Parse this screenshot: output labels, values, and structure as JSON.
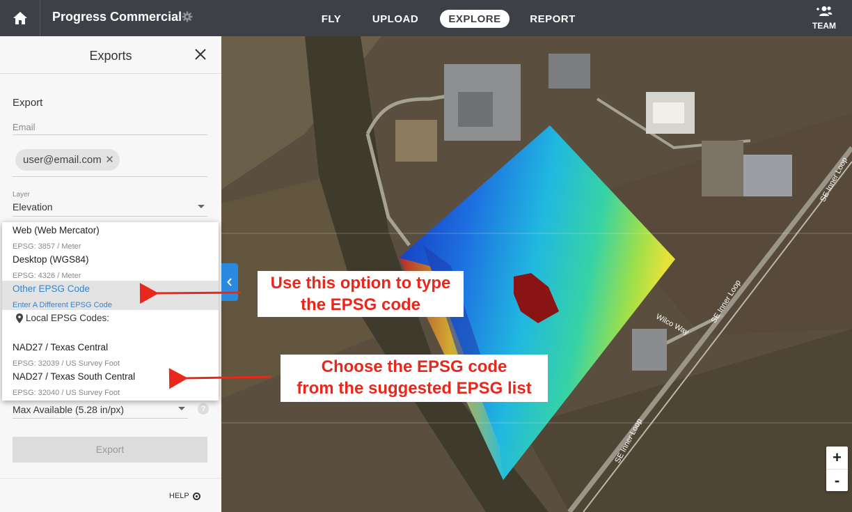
{
  "header": {
    "project_title": "Progress Commercial",
    "nav": [
      "FLY",
      "UPLOAD",
      "EXPLORE",
      "REPORT"
    ],
    "active_nav": "EXPLORE",
    "team_label": "TEAM"
  },
  "panel": {
    "title": "Exports",
    "export_label": "Export",
    "email_placeholder": "Email",
    "email_chip": "user@email.com",
    "layer_label": "Layer",
    "layer_value": "Elevation",
    "resolution_value": "Max Available (5.28 in/px)",
    "export_button": "Export",
    "help_label": "HELP"
  },
  "dropdown": {
    "options": [
      {
        "name": "Web (Web Mercator)",
        "detail": "EPSG: 3857 / Meter"
      },
      {
        "name": "Desktop (WGS84)",
        "detail": "EPSG: 4326 / Meter"
      },
      {
        "name": "Other EPSG Code",
        "detail": "Enter A Different EPSG Code"
      }
    ],
    "local_header": "Local EPSG Codes:",
    "local_options": [
      {
        "name": "NAD27 / Texas Central",
        "detail": "EPSG: 32039 / US Survey Foot"
      },
      {
        "name": "NAD27 / Texas South Central",
        "detail": "EPSG: 32040 / US Survey Foot"
      }
    ]
  },
  "callouts": {
    "top": [
      "Use this option to type",
      "the EPSG code"
    ],
    "bottom": [
      "Choose the EPSG code",
      "from the suggested EPSG list"
    ]
  },
  "map": {
    "road_labels": [
      "SE Inner Loop",
      "SE Inner Loop",
      "SE Inner Loop",
      "Wilco Way"
    ]
  },
  "zoom": {
    "in": "+",
    "out": "-"
  },
  "colors": {
    "topbar": "#3d4046",
    "accent_blue": "#2a8ae0",
    "callout_red": "#e8281c"
  }
}
